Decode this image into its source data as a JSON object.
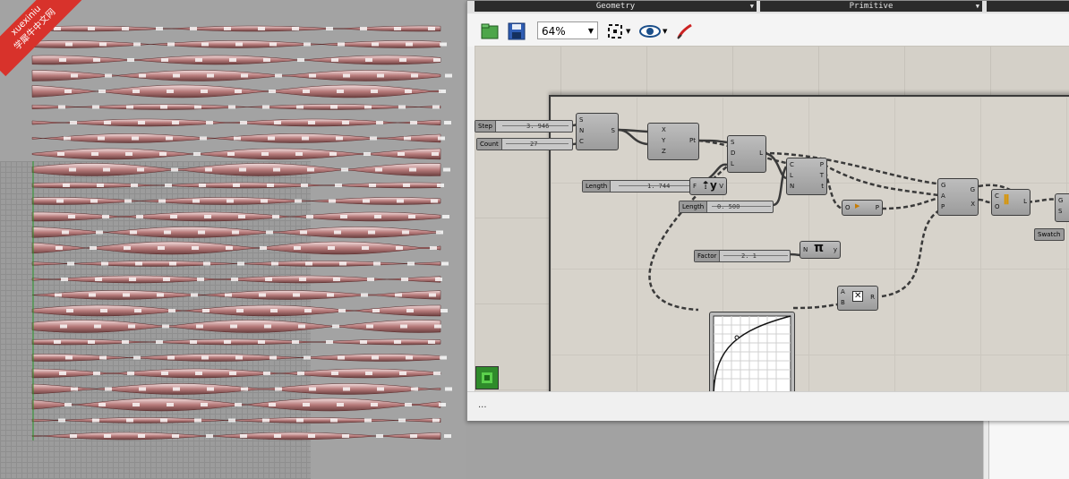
{
  "watermark": {
    "line1": "xuexiniu",
    "line2": "学犀牛中文网"
  },
  "tabs": {
    "geometry": "Geometry",
    "primitive": "Primitive"
  },
  "toolbar": {
    "zoom": "64%"
  },
  "sliders": [
    {
      "label": "Step",
      "value": "3. 946"
    },
    {
      "label": "Count",
      "value": "27"
    },
    {
      "label": "Length",
      "value": "1. 744"
    },
    {
      "label": "Length",
      "value": "0. 500"
    },
    {
      "label": "Factor",
      "value": "2. 1"
    }
  ],
  "swatch": "Swatch",
  "components": {
    "series": {
      "in": [
        "S",
        "N",
        "C"
      ],
      "out": [
        "S"
      ]
    },
    "construct_point": {
      "in": [
        "X",
        "Y",
        "Z"
      ],
      "out": [
        "Pt"
      ]
    },
    "line_sdl": {
      "in": [
        "S",
        "D",
        "L"
      ],
      "out": [
        "L"
      ]
    },
    "unit_y": {
      "in": [
        "F"
      ],
      "out": [
        "V"
      ]
    },
    "eval_curve": {
      "in": [
        "C",
        "L",
        "N"
      ],
      "out": [
        "P",
        "T",
        "t"
      ]
    },
    "vz": {
      "in": [
        "O"
      ],
      "out": [
        "P"
      ]
    },
    "pi": {
      "in": [
        "N"
      ],
      "out": [
        "y"
      ]
    },
    "multiply": {
      "in": [
        "A",
        "B"
      ],
      "out": [
        "R"
      ]
    },
    "pipe": {
      "in": [
        "G",
        "A",
        "P"
      ],
      "out": [
        "G",
        "X"
      ]
    },
    "loft": {
      "in": [
        "C",
        "O"
      ],
      "out": [
        "L"
      ]
    },
    "preview": {
      "in": [
        "G",
        "S"
      ]
    }
  },
  "status": {
    "text": "..."
  }
}
